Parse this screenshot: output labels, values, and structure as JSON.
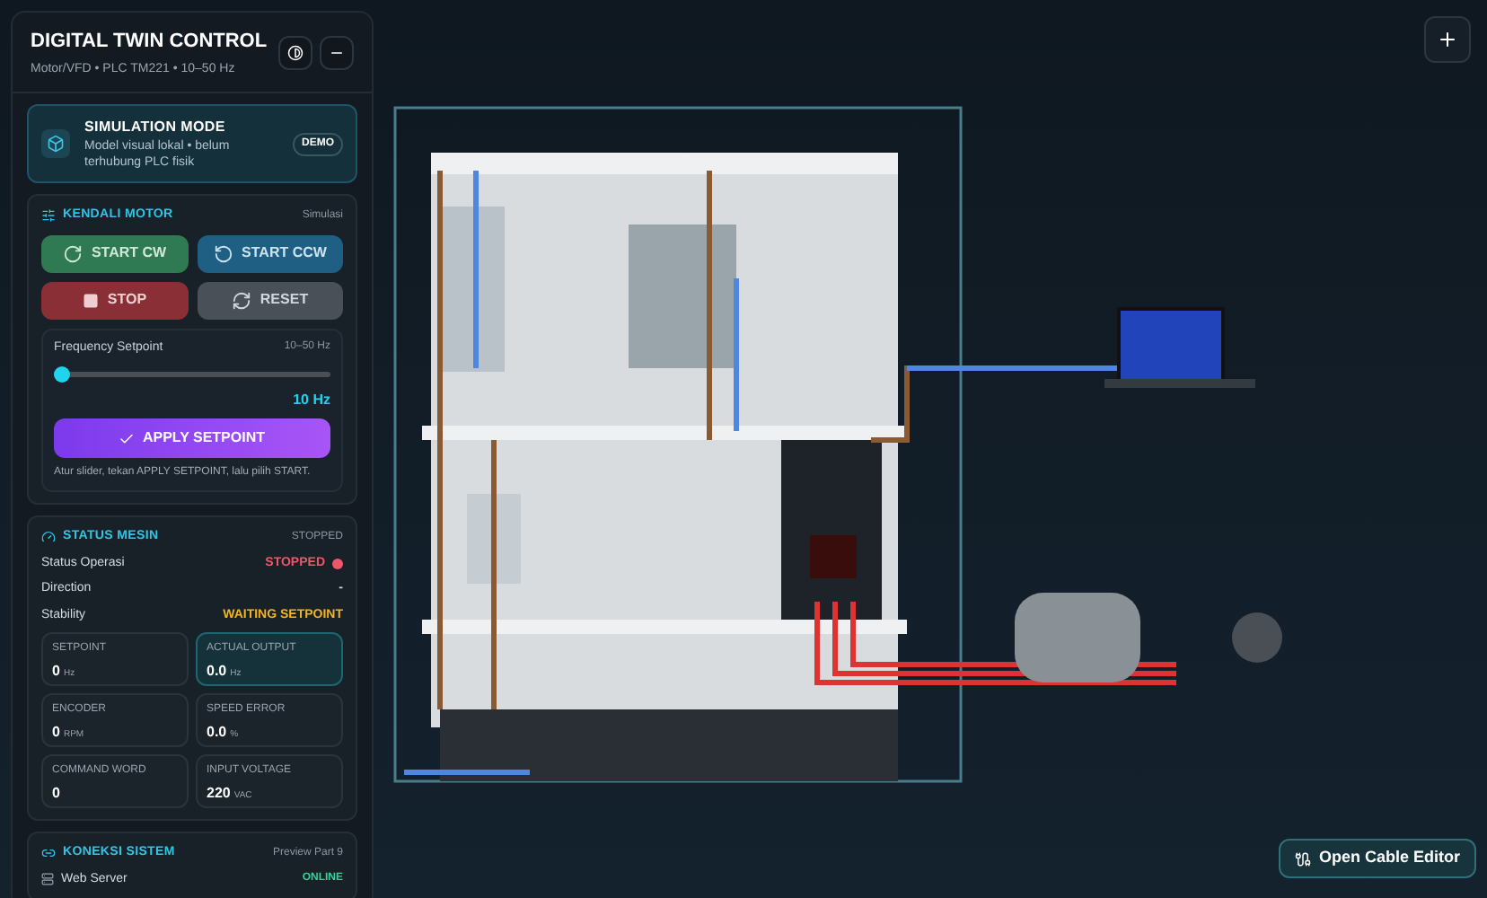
{
  "header": {
    "title": "DIGITAL TWIN CONTROL",
    "subtitle": "Motor/VFD • PLC TM221 • 10–50 Hz"
  },
  "simulation": {
    "title": "SIMULATION MODE",
    "description": "Model visual lokal • belum terhubung PLC fisik",
    "badge": "DEMO"
  },
  "motor_control": {
    "title": "KENDALI MOTOR",
    "tag": "Simulasi",
    "buttons": [
      {
        "kind": "start_cw",
        "label": "START CW"
      },
      {
        "kind": "start_ccw",
        "label": "START CCW"
      },
      {
        "kind": "stop",
        "label": "STOP"
      },
      {
        "kind": "reset",
        "label": "RESET"
      }
    ],
    "frequency": {
      "label": "Frequency Setpoint",
      "range": "10–50 Hz",
      "level": 0,
      "reading": "10 Hz"
    },
    "apply_button": "APPLY SETPOINT",
    "hint": "Atur slider, tekan APPLY SETPOINT, lalu pilih START."
  },
  "status": {
    "title": "STATUS MESIN",
    "tag": "STOPPED",
    "rows": [
      {
        "label": "Status Operasi",
        "value": "STOPPED",
        "kind": "alert"
      },
      {
        "label": "Direction",
        "value": "-",
        "kind": "plain"
      },
      {
        "label": "Stability",
        "value": "WAITING SETPOINT",
        "kind": "warning"
      }
    ],
    "tiles": [
      {
        "label": "SETPOINT",
        "value": "0",
        "unit": "Hz",
        "selected": false
      },
      {
        "label": "ACTUAL OUTPUT",
        "value": "0.0",
        "unit": "Hz",
        "selected": true
      },
      {
        "label": "ENCODER",
        "value": "0",
        "unit": "RPM",
        "selected": false
      },
      {
        "label": "SPEED ERROR",
        "value": "0.0",
        "unit": "%",
        "selected": false
      },
      {
        "label": "COMMAND WORD",
        "value": "0",
        "selected": false
      },
      {
        "label": "INPUT VOLTAGE",
        "value": "220",
        "unit": "VAC",
        "selected": false
      }
    ]
  },
  "connection": {
    "title": "KONEKSI SISTEM",
    "tag": "Preview Part 9",
    "rows": [
      {
        "label": "Web Server",
        "value": "ONLINE"
      }
    ]
  },
  "cable_editor_button": "Open Cable Editor"
}
